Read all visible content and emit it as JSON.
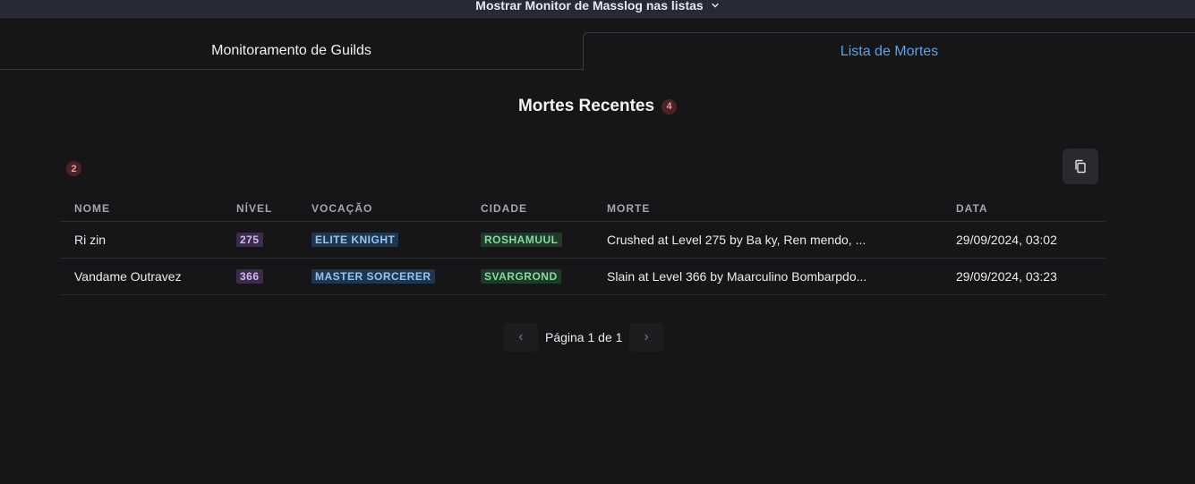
{
  "topbar": {
    "toggle_label": "Mostrar Monitor de Masslog nas listas"
  },
  "tabs": [
    {
      "label": "Monitoramento de Guilds",
      "active": false
    },
    {
      "label": "Lista de Mortes",
      "active": true
    }
  ],
  "section": {
    "title": "Mortes Recentes",
    "count": "4",
    "filtered_count": "2"
  },
  "table": {
    "headers": [
      "NOME",
      "NÍVEL",
      "VOCAÇÃO",
      "CIDADE",
      "MORTE",
      "DATA"
    ],
    "rows": [
      {
        "name": "Ri zin",
        "level": "275",
        "vocation": "ELITE KNIGHT",
        "city": "ROSHAMUUL",
        "death": "Crushed at Level 275 by Ba ky, Ren mendo, ...",
        "date": "29/09/2024, 03:02"
      },
      {
        "name": "Vandame Outravez",
        "level": "366",
        "vocation": "MASTER SORCERER",
        "city": "SVARGROND",
        "death": "Slain at Level 366 by Maarculino Bombarpdo...",
        "date": "29/09/2024, 03:23"
      }
    ]
  },
  "pagination": {
    "label": "Página 1 de 1"
  },
  "icons": {
    "copy": "copy-icon",
    "prev": "chevron-left-icon",
    "next": "chevron-right-icon",
    "toggle": "chevron-down-icon"
  },
  "colors": {
    "accent": "#5aa2e6",
    "background": "#161618"
  }
}
